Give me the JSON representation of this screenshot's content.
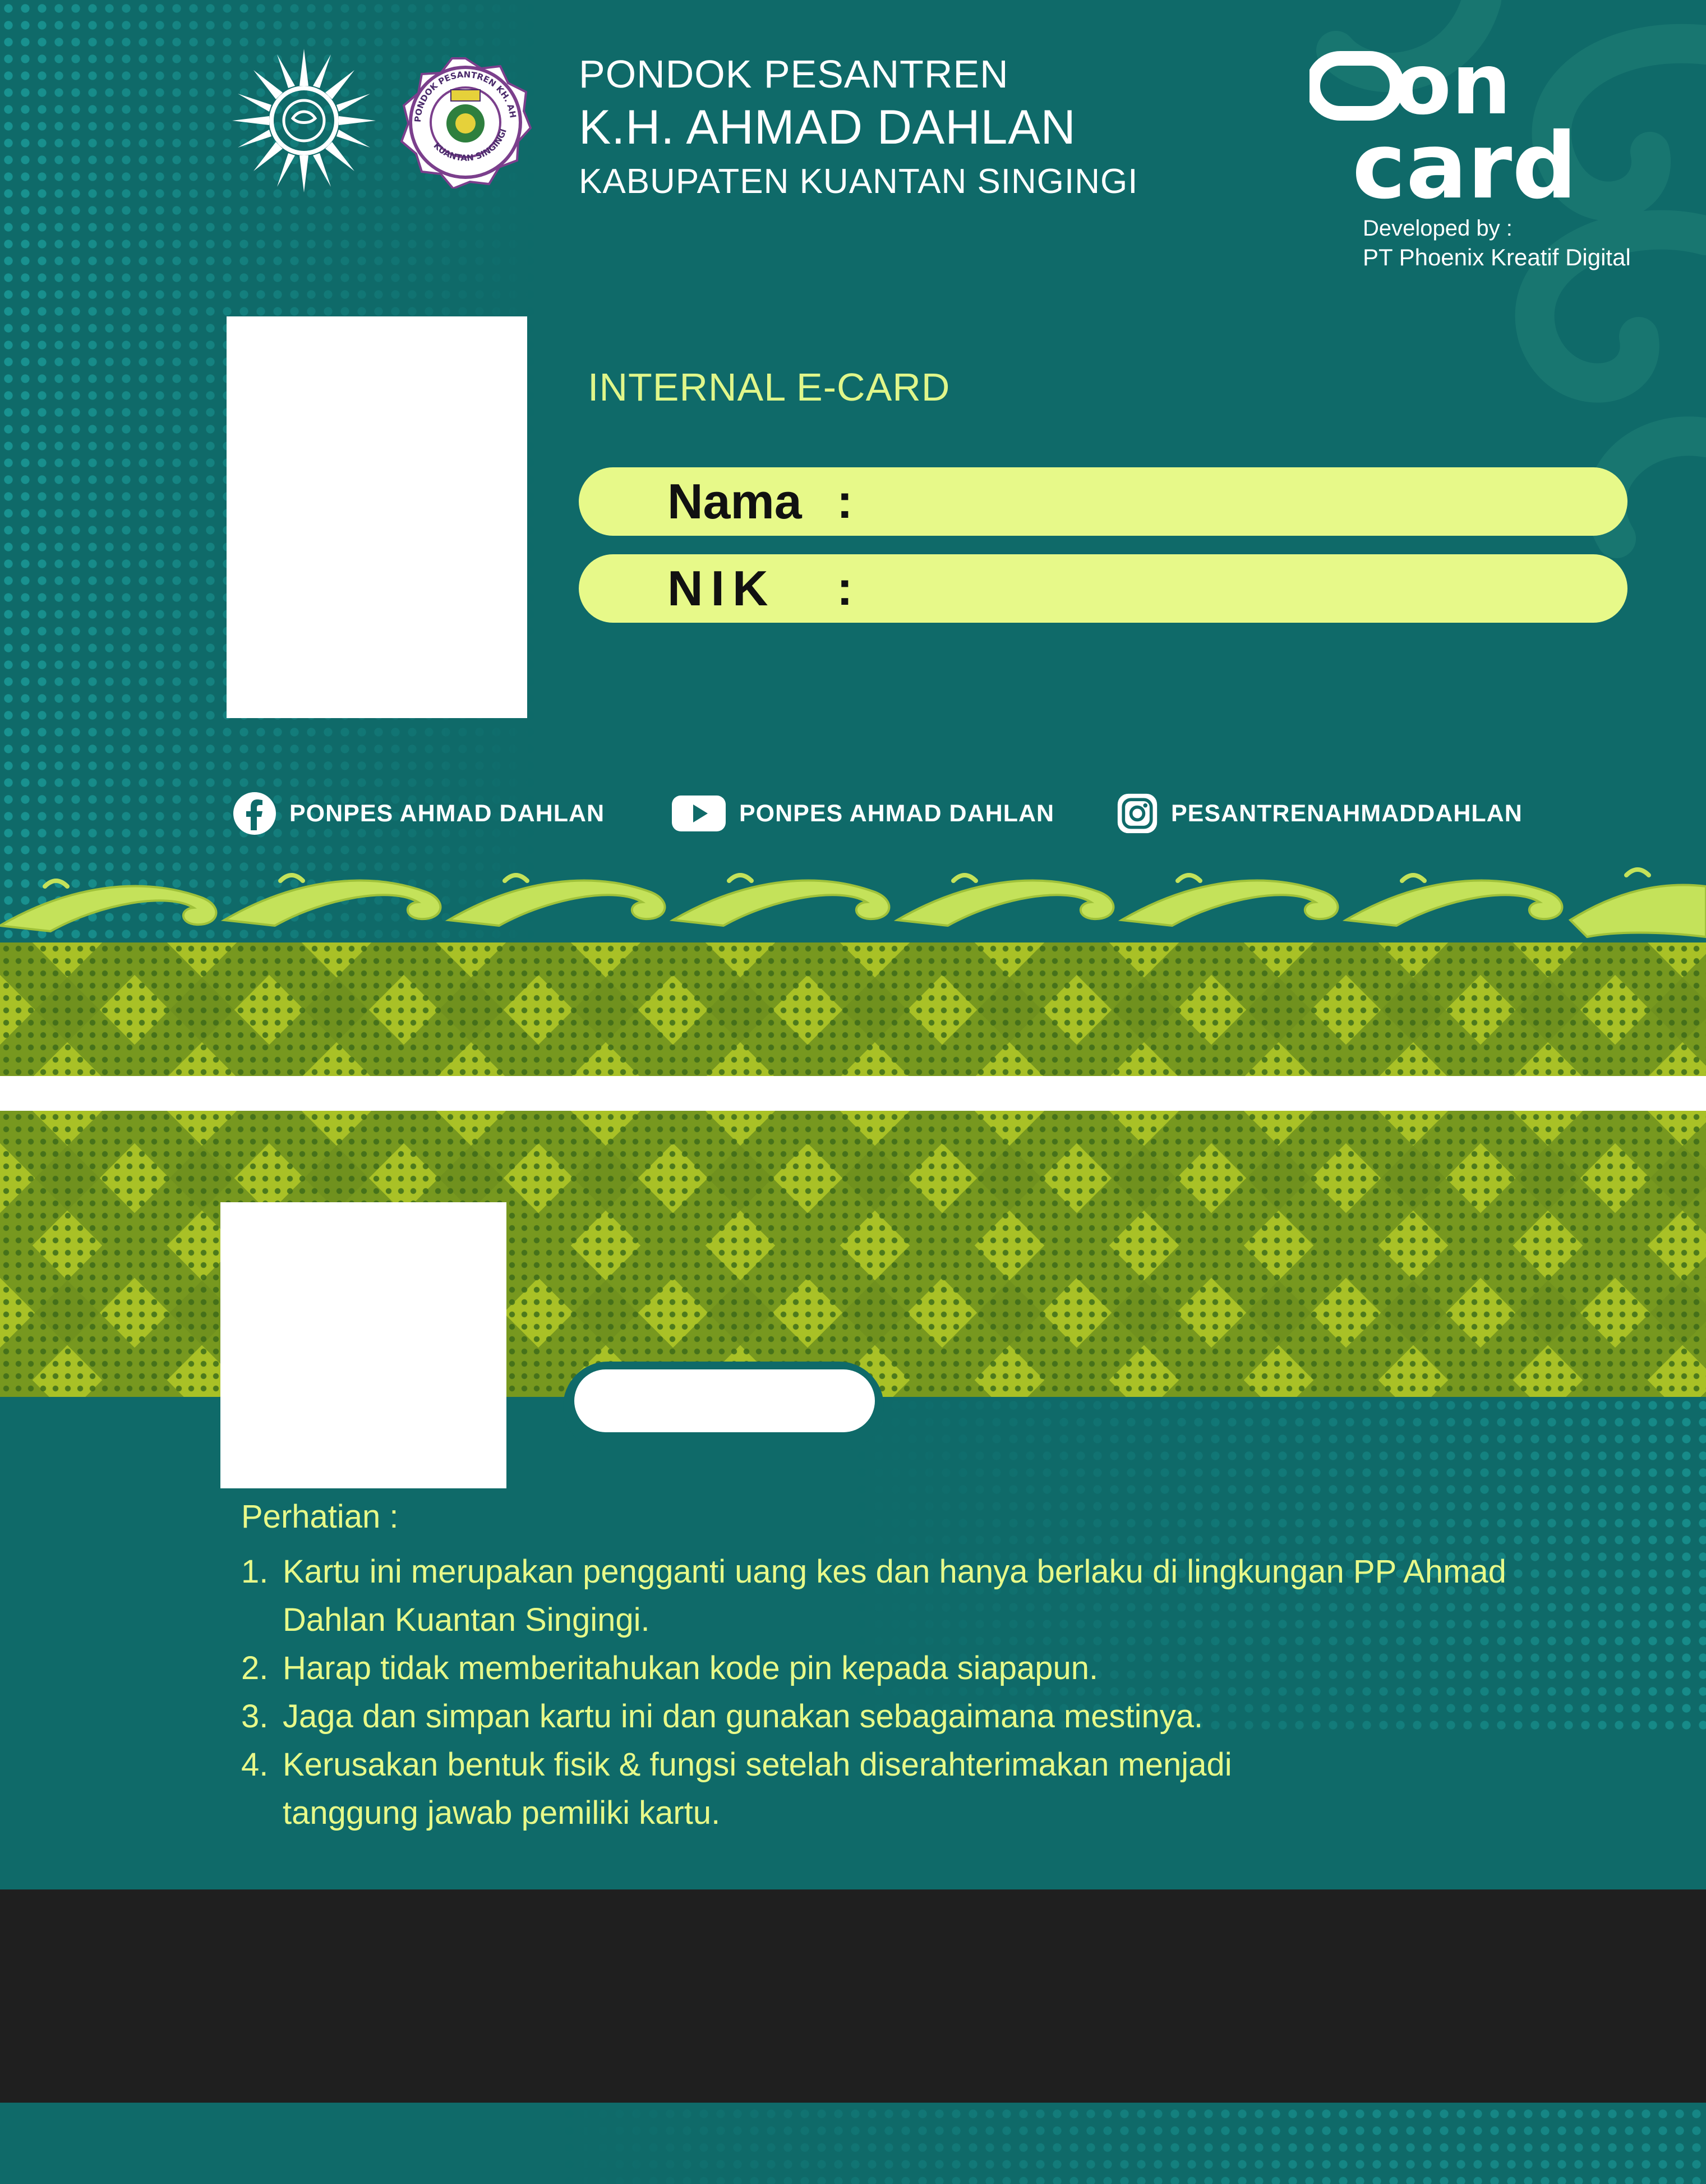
{
  "front": {
    "school": {
      "line1": "PONDOK PESANTREN",
      "line2": "K.H. AHMAD DAHLAN",
      "line3": "KABUPATEN KUANTAN SINGINGI"
    },
    "brand": {
      "logo_top": "on",
      "logo_bottom": "card",
      "developed_by": "Developed by :",
      "developer": "PT Phoenix Kreatif Digital"
    },
    "card_type": "INTERNAL E-CARD",
    "fields": [
      {
        "label": "Nama",
        "value": ""
      },
      {
        "label": "NIK",
        "value": ""
      }
    ],
    "separator": ":",
    "social": [
      {
        "icon": "facebook-icon",
        "handle": "PONPES AHMAD DAHLAN"
      },
      {
        "icon": "youtube-icon",
        "handle": "PONPES AHMAD DAHLAN"
      },
      {
        "icon": "instagram-icon",
        "handle": "PESANTRENAHMADDAHLAN"
      }
    ],
    "logos": {
      "org_logo_text": "muhammadiyah",
      "seal_ring_text": "PONDOK PESANTREN KH. AHMAD DAHLAN",
      "seal_bottom_text": "KUANTAN SINGINGI"
    }
  },
  "back": {
    "notice_title": "Perhatian :",
    "notice_items": [
      {
        "num": "1.",
        "text": "Kartu ini merupakan pengganti uang kes dan hanya berlaku di lingkungan PP Ahmad Dahlan Kuantan Singingi."
      },
      {
        "num": "2.",
        "text": "Harap tidak memberitahukan kode pin kepada siapapun."
      },
      {
        "num": "3.",
        "text": "Jaga dan simpan kartu ini dan gunakan sebagaimana mestinya."
      },
      {
        "num": "4.",
        "text": "Kerusakan bentuk fisik & fungsi setelah diserahterimakan menjadi tanggung jawab pemiliki kartu."
      }
    ]
  },
  "colors": {
    "teal_background": "#0f6a69",
    "lime_accent": "#e7f989",
    "pattern_green": "#a9c126",
    "stripe_dark": "#1f1f1f"
  }
}
